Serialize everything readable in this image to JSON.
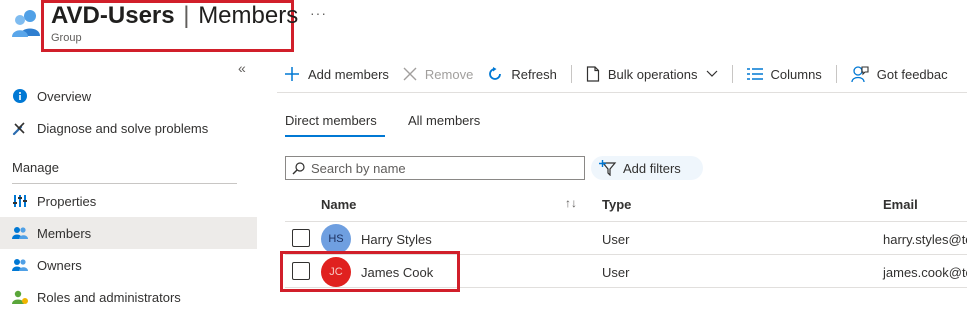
{
  "header": {
    "title_bold": "AVD-Users",
    "title_sep": "|",
    "title_rest": "Members",
    "subtitle": "Group",
    "more": "···"
  },
  "sidebar": {
    "collapse": "«",
    "items": [
      {
        "label": "Overview",
        "icon": "info-icon"
      },
      {
        "label": "Diagnose and solve problems",
        "icon": "wrench-icon"
      }
    ],
    "section": "Manage",
    "manage_items": [
      {
        "label": "Properties",
        "icon": "properties-icon"
      },
      {
        "label": "Members",
        "icon": "members-icon",
        "active": true
      },
      {
        "label": "Owners",
        "icon": "owners-icon"
      },
      {
        "label": "Roles and administrators",
        "icon": "roles-icon"
      }
    ]
  },
  "toolbar": {
    "add": "Add members",
    "remove": "Remove",
    "refresh": "Refresh",
    "bulk": "Bulk operations",
    "columns": "Columns",
    "feedback": "Got feedbac"
  },
  "tabs": [
    {
      "label": "Direct members",
      "selected": true
    },
    {
      "label": "All members",
      "selected": false
    }
  ],
  "search": {
    "placeholder": "Search by name"
  },
  "filters": {
    "label": "Add filters"
  },
  "table": {
    "columns": [
      "Name",
      "Type",
      "Email"
    ],
    "rows": [
      {
        "initials": "HS",
        "name": "Harry Styles",
        "type": "User",
        "email": "harry.styles@to",
        "avatar_bg": "#6f9fe0",
        "avatar_fg": "#1b2f5e"
      },
      {
        "initials": "JC",
        "name": "James Cook",
        "type": "User",
        "email": "james.cook@to",
        "avatar_bg": "#e0211f",
        "avatar_fg": "#f6c9c3"
      }
    ]
  },
  "colors": {
    "accent": "#0078d4",
    "highlight": "#d11f2a"
  }
}
